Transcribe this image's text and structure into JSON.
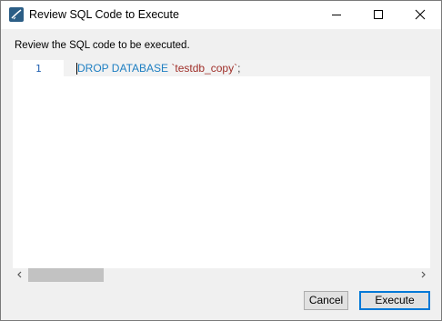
{
  "window": {
    "title": "Review SQL Code to Execute"
  },
  "titlebar": {
    "minimize_icon": "minimize-icon",
    "maximize_icon": "maximize-icon",
    "close_icon": "close-icon"
  },
  "prompt": "Review the SQL code to be executed.",
  "editor": {
    "lines": [
      {
        "number": "1",
        "keyword": "DROP DATABASE",
        "space": " ",
        "identifier": "`testdb_copy`",
        "terminator": ";"
      }
    ]
  },
  "buttons": {
    "cancel": "Cancel",
    "execute": "Execute"
  }
}
